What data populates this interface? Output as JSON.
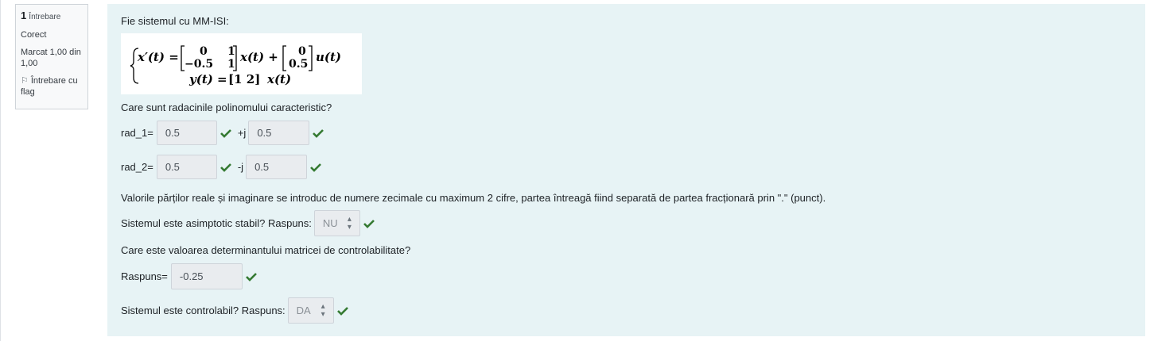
{
  "question_info": {
    "number": "1",
    "word": "Întrebare",
    "state": "Corect",
    "grade": "Marcat 1,00 din 1,00",
    "flag_label": "Întrebare cu flag"
  },
  "question": {
    "intro": "Fie sistemul cu MM-ISI:",
    "prompt_roots": "Care sunt radacinile polinomului caracteristic?",
    "rad1": {
      "label": "rad_1=",
      "real": "0.5",
      "sep": "+j",
      "imag": "0.5"
    },
    "rad2": {
      "label": "rad_2=",
      "real": "0.5",
      "sep": "-j",
      "imag": "0.5"
    },
    "note": "Valorile părților reale și imaginare se introduc de numere zecimale cu maximum 2 cifre, partea întreagă fiind separată de partea fracționară prin \".\" (punct).",
    "stable_label": "Sistemul este asimptotic stabil? Raspuns:",
    "stable_value": "NU",
    "det_prompt": "Care este valoarea determinantului matricei de controlabilitate?",
    "det_label": "Raspuns=",
    "det_value": "-0.25",
    "control_label": "Sistemul este controlabil? Raspuns:",
    "control_value": "DA"
  },
  "colors": {
    "check": "#357a32",
    "panel": "#e7f3f5"
  }
}
